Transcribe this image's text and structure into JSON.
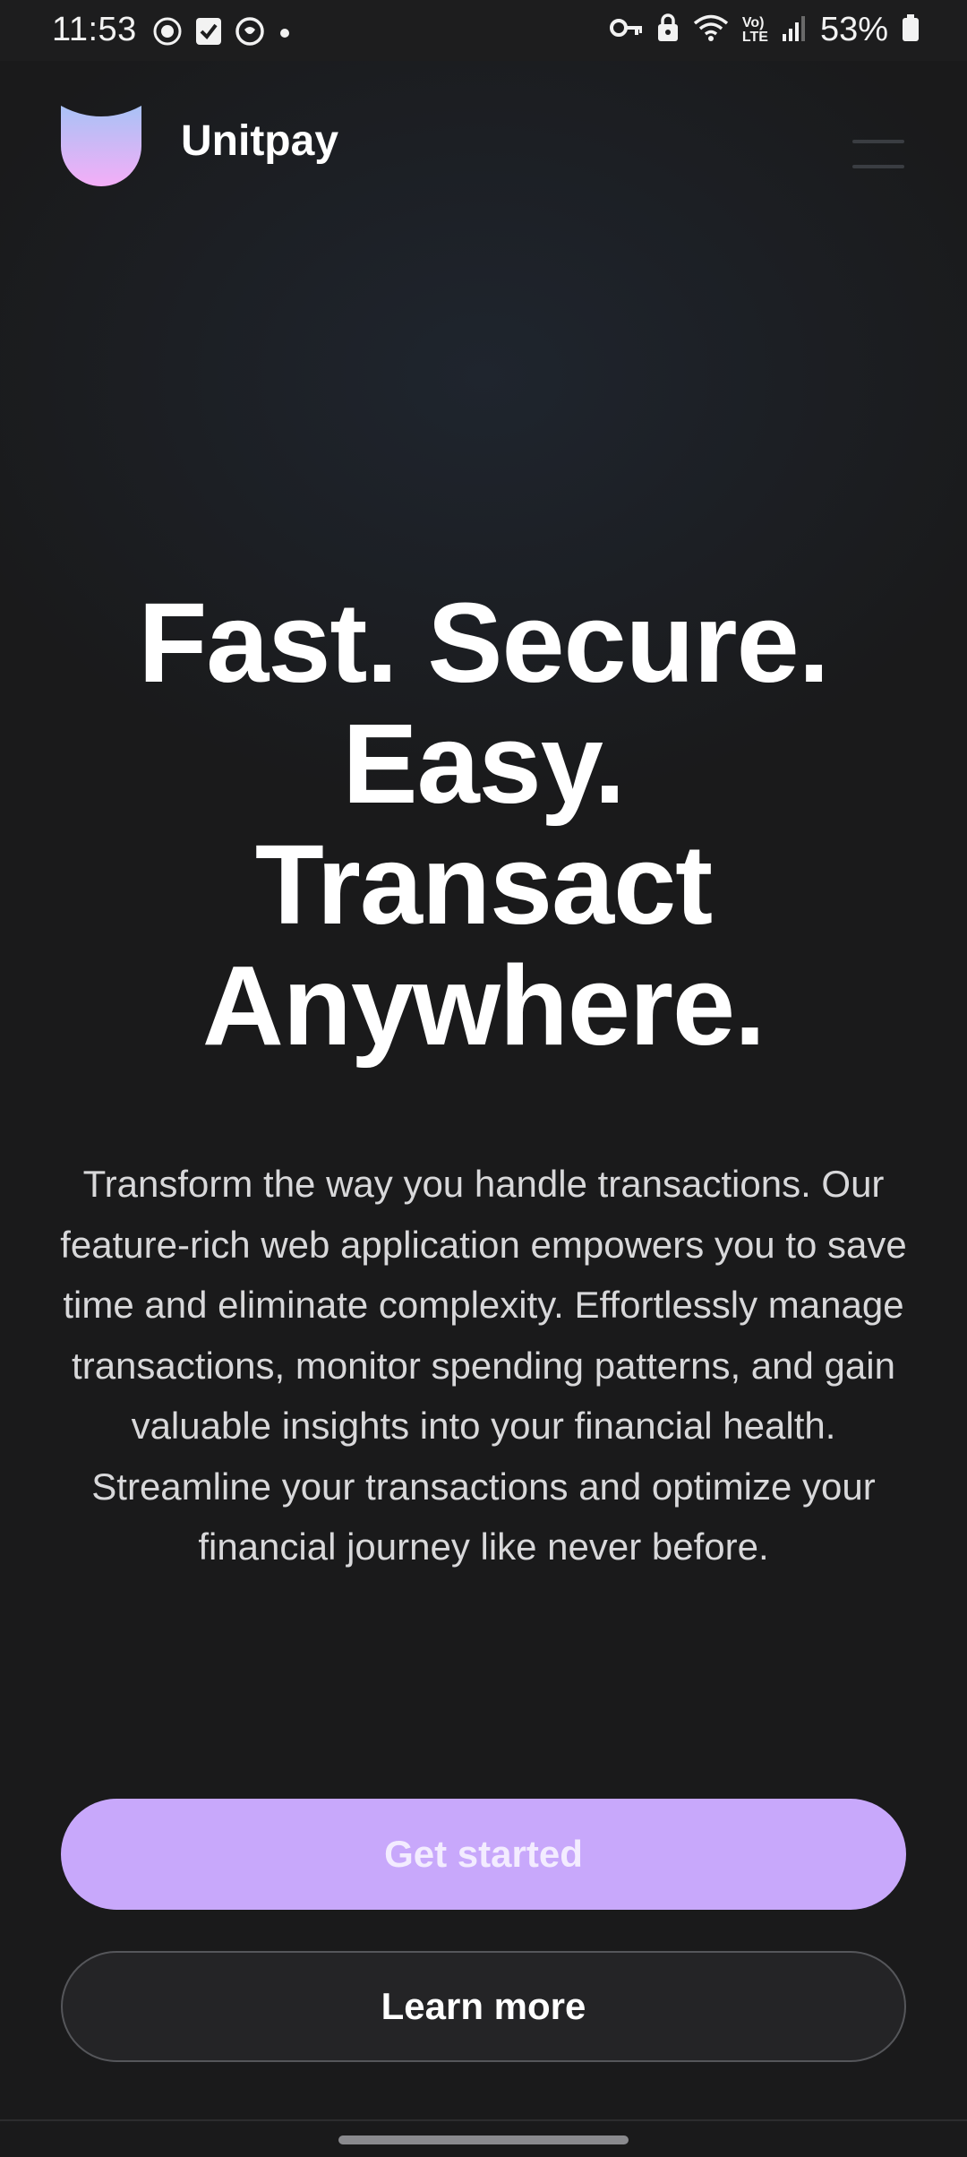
{
  "status_bar": {
    "time": "11:53",
    "battery_percent": "53%",
    "network_label_top": "Vo)",
    "network_label_bottom": "LTE",
    "left_icons": [
      "whatsapp-icon",
      "checkbox-icon",
      "focus-icon",
      "dot-icon"
    ],
    "right_icons": [
      "vpn-key-icon",
      "lock-icon",
      "wifi-icon",
      "volte-icon",
      "signal-icon",
      "battery-icon"
    ]
  },
  "header": {
    "brand_name": "Unitpay",
    "menu_icon": "hamburger-menu-icon"
  },
  "hero": {
    "title_lines": [
      "Fast. Secure.",
      "Easy.",
      "Transact",
      "Anywhere."
    ],
    "description": "Transform the way you handle transactions. Our feature-rich web application empowers you to save time and eliminate complexity. Effortlessly manage transactions, monitor spending patterns, and gain valuable insights into your financial health. Streamline your transactions and optimize your financial journey like never before."
  },
  "actions": {
    "primary_label": "Get started",
    "secondary_label": "Learn more"
  },
  "colors": {
    "background": "#1a1a1b",
    "primary_button": "#c8a8fb",
    "logo_gradient_top": "#a9c2f6",
    "logo_gradient_bottom": "#f4aef7"
  }
}
